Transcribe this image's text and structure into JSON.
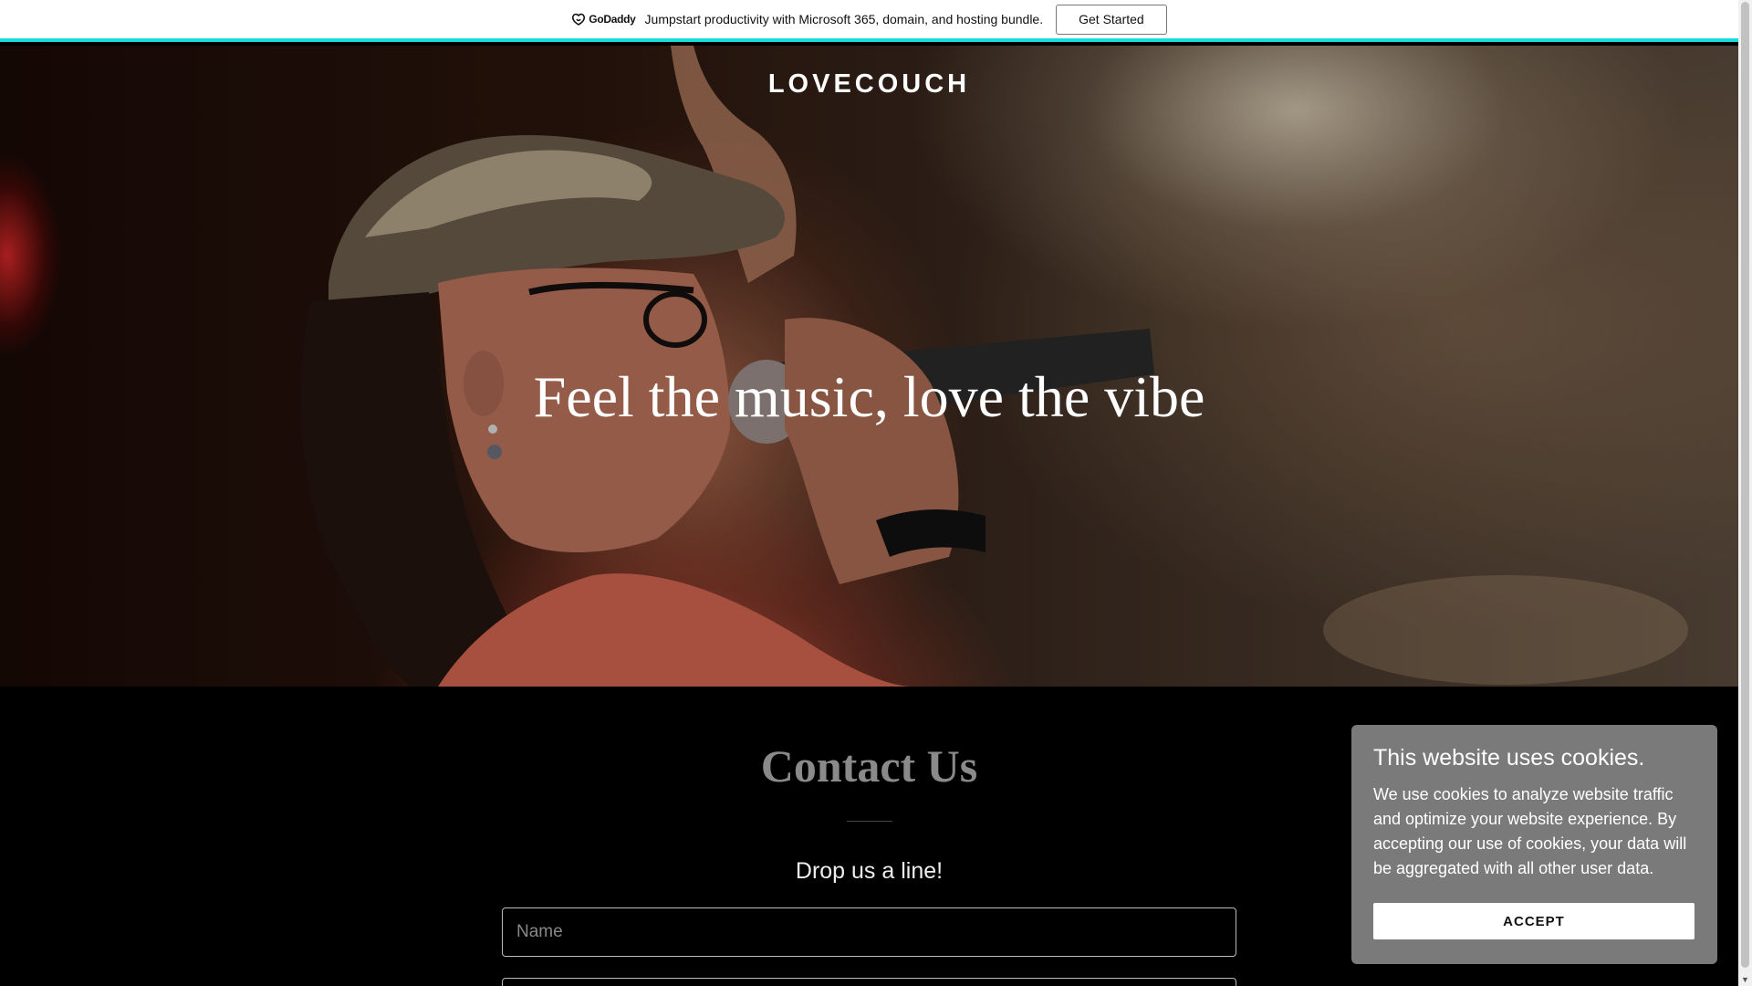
{
  "promo": {
    "logo_text": "GoDaddy",
    "message": "Jumpstart productivity with Microsoft 365, domain, and hosting bundle.",
    "cta_label": "Get Started",
    "accent_color": "#1bdbdb"
  },
  "hero": {
    "site_title": "LOVECOUCH",
    "heading": "Feel the music, love the vibe"
  },
  "contact": {
    "title": "Contact Us",
    "subtitle": "Drop us a line!",
    "name_placeholder": "Name"
  },
  "cookie_banner": {
    "title": "This website uses cookies.",
    "body": "We use cookies to analyze website traffic and optimize your website experience. By accepting our use of cookies, your data will be aggregated with all other user data.",
    "accept_label": "ACCEPT"
  },
  "icons": {
    "promo_logo": "godaddy-logo-icon",
    "scroll_down": "chevron-down-icon"
  }
}
